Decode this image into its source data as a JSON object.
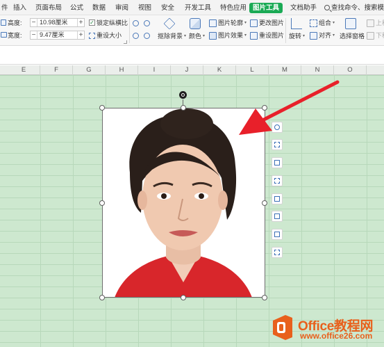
{
  "menubar": {
    "tabs": [
      {
        "label": "件",
        "active": false
      },
      {
        "label": "插入",
        "active": false
      },
      {
        "label": "页面布局",
        "active": false
      },
      {
        "label": "公式",
        "active": false
      },
      {
        "label": "数据",
        "active": false
      },
      {
        "label": "审阅",
        "active": false
      },
      {
        "label": "视图",
        "active": false
      },
      {
        "label": "安全",
        "active": false
      },
      {
        "label": "开发工具",
        "active": false
      },
      {
        "label": "特色应用",
        "active": false
      },
      {
        "label": "图片工具",
        "active": true
      },
      {
        "label": "文档助手",
        "active": false
      }
    ],
    "search_label": "查找命令、搜索模板",
    "accent_color": "#1aaa55"
  },
  "ribbon": {
    "height_label": "高度:",
    "height_value": "10.98厘米",
    "width_label": "宽度:",
    "width_value": "9.47厘米",
    "lock_ratio_label": "锁定纵横比",
    "lock_ratio_checked": true,
    "reset_size_label": "重设大小",
    "remove_bg_label": "抠除背景",
    "color_label": "颜色",
    "outline_label": "图片轮廓",
    "effect_label": "图片效果",
    "change_pic_label": "更改图片",
    "reset_pic_label": "重设图片",
    "rotate_label": "旋转",
    "group_label": "组合",
    "align_label": "对齐",
    "selection_pane_label": "选择窗格",
    "move_up_label": "上移",
    "move_down_label": "下移"
  },
  "sheet": {
    "columns": [
      "E",
      "F",
      "G",
      "H",
      "I",
      "J",
      "K",
      "L",
      "M",
      "N",
      "O"
    ],
    "cell_color": "#cde8cf"
  },
  "picture": {
    "semantic": "portrait-photo-woman"
  },
  "side_toolbar": {
    "icons": [
      "zoom-icon",
      "crop-fit-icon",
      "crop-icon",
      "picture-style-icon",
      "bring-forward-icon",
      "wrap-text-icon",
      "send-backward-icon",
      "picture-layout-icon"
    ]
  },
  "watermark": {
    "brand": "Office教程网",
    "url": "www.office26.com",
    "color": "#e8601c"
  },
  "annotation": {
    "arrow_color": "#e8202a"
  }
}
